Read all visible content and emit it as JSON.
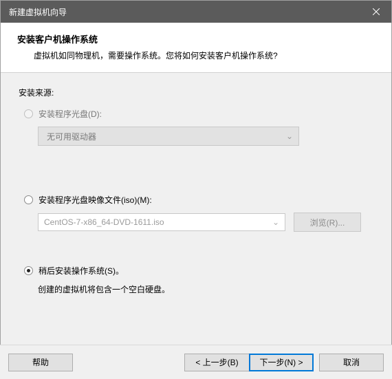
{
  "window": {
    "title": "新建虚拟机向导"
  },
  "header": {
    "heading": "安装客户机操作系统",
    "subheading": "虚拟机如同物理机，需要操作系统。您将如何安装客户机操作系统?"
  },
  "content": {
    "source_label": "安装来源:",
    "option_disc": {
      "label": "安装程序光盘(D):",
      "dropdown_value": "无可用驱动器"
    },
    "option_iso": {
      "label": "安装程序光盘映像文件(iso)(M):",
      "file_value": "CentOS-7-x86_64-DVD-1611.iso",
      "browse_label": "浏览(R)..."
    },
    "option_later": {
      "label": "稍后安装操作系统(S)。",
      "hint": "创建的虚拟机将包含一个空白硬盘。"
    }
  },
  "footer": {
    "help": "帮助",
    "back": "< 上一步(B)",
    "next": "下一步(N) >",
    "cancel": "取消"
  }
}
